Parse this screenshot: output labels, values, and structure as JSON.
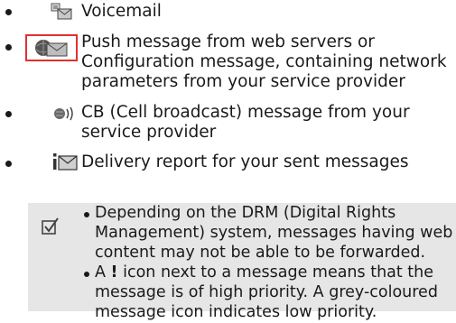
{
  "items": [
    {
      "icon": "voicemail-icon",
      "lines": [
        "Voicemail"
      ]
    },
    {
      "icon": "push-message-icon",
      "lines": [
        "Push message from web servers or",
        "Configuration message, containing network",
        "parameters from your service provider"
      ]
    },
    {
      "icon": "cell-broadcast-icon",
      "lines": [
        "CB (Cell broadcast) message from your",
        "service provider"
      ]
    },
    {
      "icon": "delivery-report-icon",
      "lines": [
        "Delivery report for your sent messages"
      ]
    }
  ],
  "note": {
    "icon": "checkmark-note-icon",
    "bullets": [
      {
        "lines": [
          "Depending on the DRM (Digital Rights",
          "Management) system, messages having web",
          "content may not be able to be forwarded."
        ]
      },
      {
        "prefix": "A ",
        "bold": "!",
        "lines_first_rest": " icon next to a message means that the",
        "lines": [
          "message is of high priority. A grey-coloured",
          "message icon indicates low priority."
        ]
      }
    ]
  },
  "colors": {
    "highlight": "#e03030",
    "note_bg": "#e6e6e6"
  }
}
